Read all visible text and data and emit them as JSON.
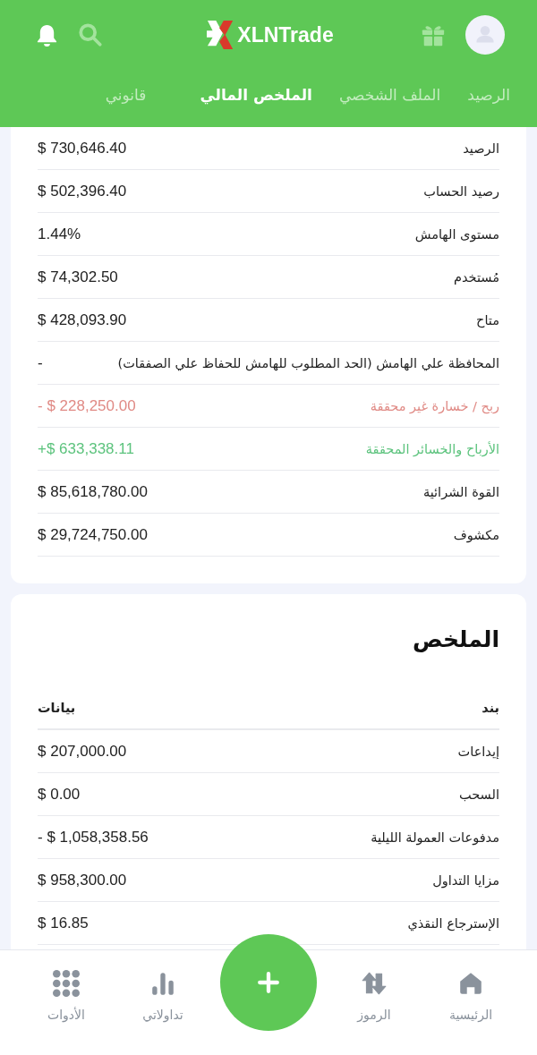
{
  "header": {
    "logo_text": "XLNTrade"
  },
  "tabs": [
    {
      "label": "الرصيد",
      "selected": false
    },
    {
      "label": "الملف الشخصي",
      "selected": false
    },
    {
      "label": "الملخص المالي",
      "selected": true
    },
    {
      "label": "قانوني",
      "selected": false
    }
  ],
  "account_rows": [
    {
      "label": "الرصيد",
      "value": "$ 730,646.40",
      "kind": "normal"
    },
    {
      "label": "رصيد الحساب",
      "value": "$ 502,396.40",
      "kind": "normal"
    },
    {
      "label": "مستوى الهامش",
      "value": "1.44%",
      "kind": "normal"
    },
    {
      "label": "مُستخدم",
      "value": "$ 74,302.50",
      "kind": "normal"
    },
    {
      "label": "متاح",
      "value": "$ 428,093.90",
      "kind": "normal"
    },
    {
      "label": "المحافظة علي الهامش (الحد المطلوب للهامش للحفاظ علي الصفقات)",
      "value": "-",
      "kind": "normal"
    },
    {
      "label": "ربح / خسارة غير محققة",
      "value": "- $ 228,250.00",
      "kind": "negative"
    },
    {
      "label": "الأرباح والخسائر المحققة",
      "value": "+$ 633,338.11",
      "kind": "positive"
    },
    {
      "label": "القوة الشرائية",
      "value": "$ 85,618,780.00",
      "kind": "normal"
    },
    {
      "label": "مكشوف",
      "value": "$ 29,724,750.00",
      "kind": "normal"
    }
  ],
  "summary": {
    "title": "الملخص",
    "columns": [
      "بند",
      "بيانات"
    ],
    "rows": [
      {
        "label": "إيداعات",
        "value": "$ 207,000.00"
      },
      {
        "label": "السحب",
        "value": "$ 0.00"
      },
      {
        "label": "مدفوعات العمولة الليلية",
        "value": "- $ 1,058,358.56"
      },
      {
        "label": "مزايا التداول",
        "value": "$ 958,300.00"
      },
      {
        "label": "الإسترجاع النقذي",
        "value": "$ 16.85"
      }
    ]
  },
  "bottom_nav": [
    {
      "label": "الرئيسية",
      "kind": "home"
    },
    {
      "label": "الرموز",
      "kind": "symbols"
    },
    {
      "kind": "add"
    },
    {
      "label": "تداولاتي",
      "kind": "trades"
    },
    {
      "label": "الأدوات",
      "kind": "tools"
    }
  ]
}
